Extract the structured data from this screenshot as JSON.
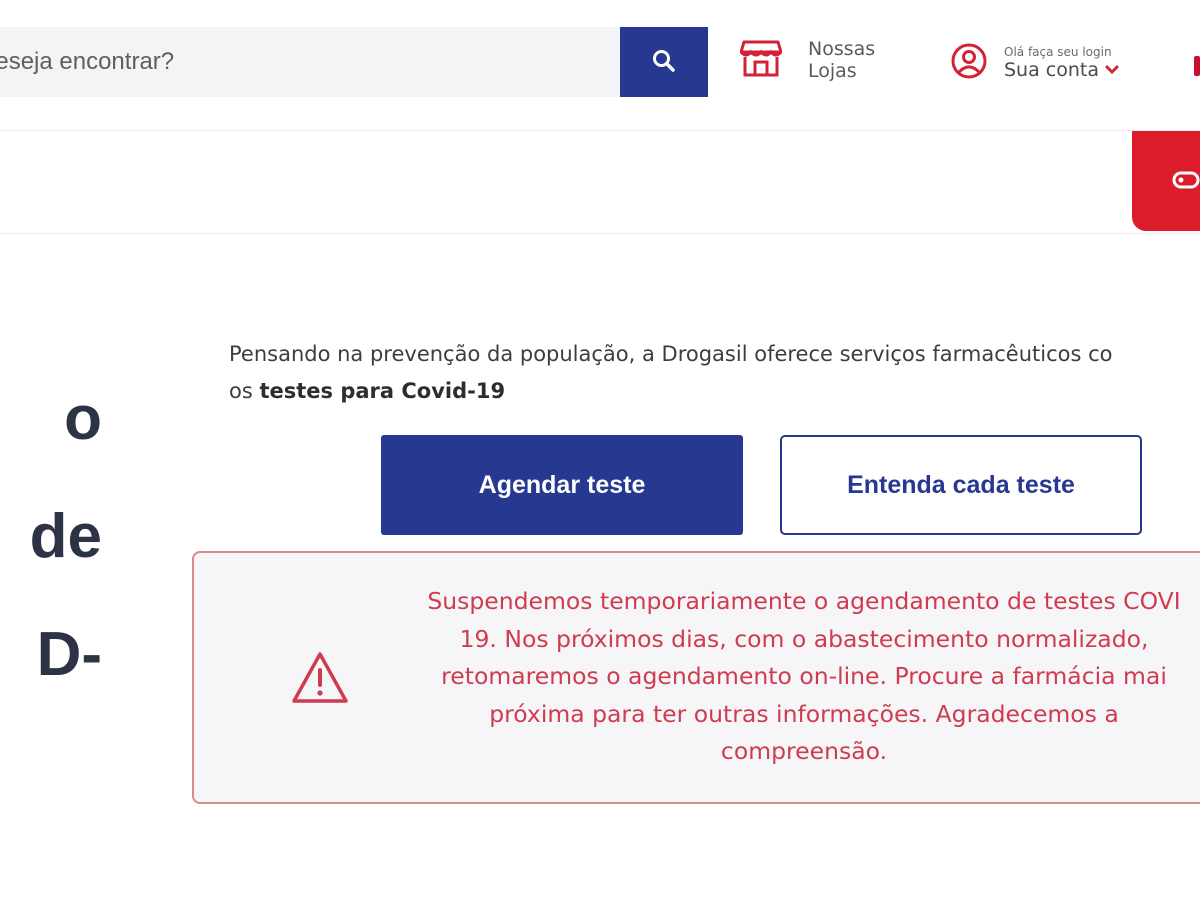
{
  "header": {
    "search": {
      "placeholder": "deseja encontrar?"
    },
    "stores": {
      "line1": "Nossas",
      "line2": "Lojas"
    },
    "account": {
      "greeting": "Olá faça seu login",
      "label": "Sua conta"
    }
  },
  "hero": {
    "title_lines": [
      "o",
      "de",
      "D-"
    ],
    "intro_prefix": "Pensando na prevenção da população, a Drogasil oferece serviços farmacêuticos co",
    "intro_line2_prefix": "os ",
    "intro_bold": "testes para Covid-19"
  },
  "actions": {
    "schedule_label": "Agendar teste",
    "understand_label": "Entenda cada teste"
  },
  "alert": {
    "lines": [
      "Suspendemos temporariamente o agendamento de testes COVI",
      "19. Nos próximos dias, com o abastecimento normalizado,",
      "retomaremos o agendamento on-line. Procure a farmácia mai",
      "próxima para ter outras informações. Agradecemos a",
      "compreensão."
    ]
  },
  "colors": {
    "brand_blue": "#273891",
    "brand_red": "#dc1b2b",
    "alert_text": "#cf3c4f",
    "alert_border": "#d98a8f"
  },
  "icons": {
    "search": "search-icon",
    "stores": "store-icon",
    "account": "user-circle-icon",
    "chevron": "chevron-down-icon",
    "tab": "tag-icon",
    "alert": "warning-icon"
  }
}
